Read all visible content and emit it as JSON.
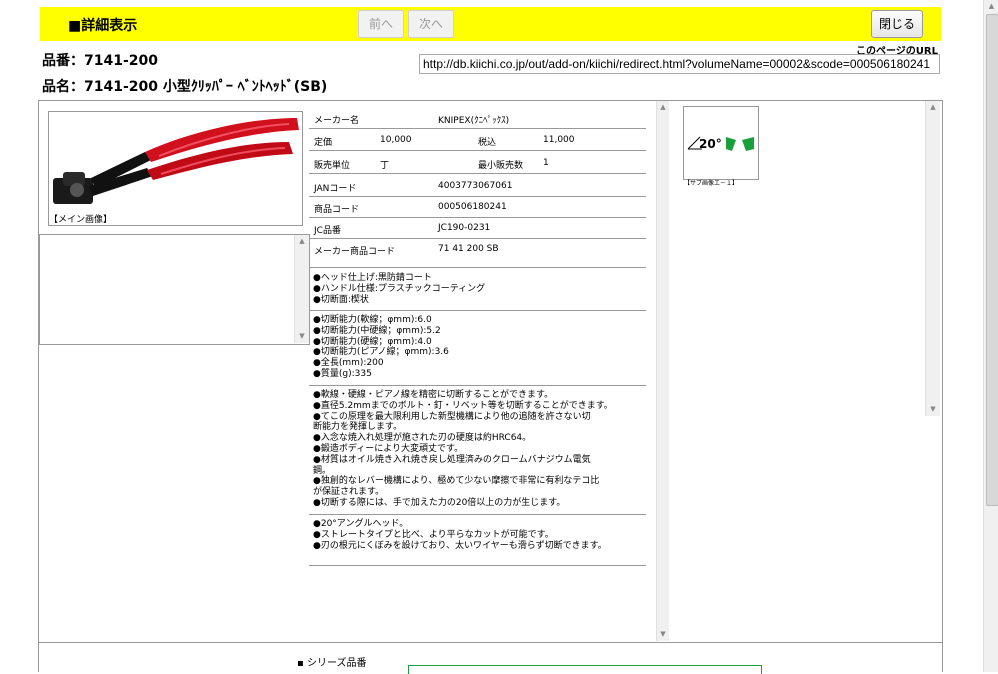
{
  "header": {
    "title": "■詳細表示",
    "prev_label": "前へ",
    "next_label": "次へ",
    "close_label": "閉じる"
  },
  "product": {
    "code_line": "品番：7141-200",
    "name_line": "品名：7141-200 小型ｸﾘｯﾊﾟｰ ﾍﾞﾝﾄﾍｯﾄﾞ(SB)"
  },
  "page_url": {
    "label": "このページのURL",
    "value": "http://db.kiichi.co.jp/out/add-on/kiichi/redirect.html?volumeName=00002&scode=000506180241"
  },
  "images": {
    "main_caption": "【メイン画像】",
    "sub_caption": "【サブ画像エ－１】",
    "sub_angle_label": "20°"
  },
  "spec": {
    "maker_label": "メーカー名",
    "maker_value": "KNIPEX(ｸﾆﾍﾟｯｸｽ)",
    "price_label": "定価",
    "price_value": "10,000",
    "taxin_label": "税込",
    "taxin_value": "11,000",
    "unit_label": "販売単位",
    "unit_value": "丁",
    "minqty_label": "最小販売数",
    "minqty_value": "1",
    "jan_label": "JANコード",
    "jan_value": "4003773067061",
    "item_label": "商品コード",
    "item_value": "000506180241",
    "jc_label": "JC品番",
    "jc_value": "JC190-0231",
    "maker_item_label": "メーカー商品コード",
    "maker_item_value": "71 41 200 SB"
  },
  "features": {
    "block1": [
      "●ヘッド仕上げ:黒防錆コート",
      "●ハンドル仕様:プラスチックコーティング",
      "●切断面:楔状"
    ],
    "block2": [
      "●切断能力(軟線；φmm):6.0",
      "●切断能力(中硬線；φmm):5.2",
      "●切断能力(硬線；φmm):4.0",
      "●切断能力(ピアノ線；φmm):3.6",
      "●全長(mm):200",
      "●質量(g):335"
    ],
    "block3": [
      "●軟線・硬線・ピアノ線を精密に切断することができます。",
      "●直径5.2mmまでのボルト・釘・リベット等を切断することができます。",
      "●てこの原理を最大限利用した新型機構により他の追随を許さない切",
      "断能力を発揮します。",
      "●入念な焼入れ処理が施された刃の硬度は約HRC64。",
      "●鍛造ボディーにより大変頑丈です。",
      "●材質はオイル焼き入れ焼き戻し処理済みのクロームバナジウム電気",
      "鋼。",
      "●独創的なレバー機構により、極めて少ない摩擦で非常に有利なテコ比",
      "が保証されます。",
      "●切断する際には、手で加えた力の20倍以上の力が生じます。"
    ],
    "block4": [
      "●20°アングルヘッド。",
      "●ストレートタイプと比べ、より平らなカットが可能です。",
      "●刃の根元にくぼみを設けており、太いワイヤーも滑らず切断できます。"
    ]
  },
  "series": {
    "label": "シリーズ品番"
  },
  "colors": {
    "header_bg": "#ffff00",
    "handle_red": "#d0101c",
    "angle_green": "#1aa03a"
  }
}
